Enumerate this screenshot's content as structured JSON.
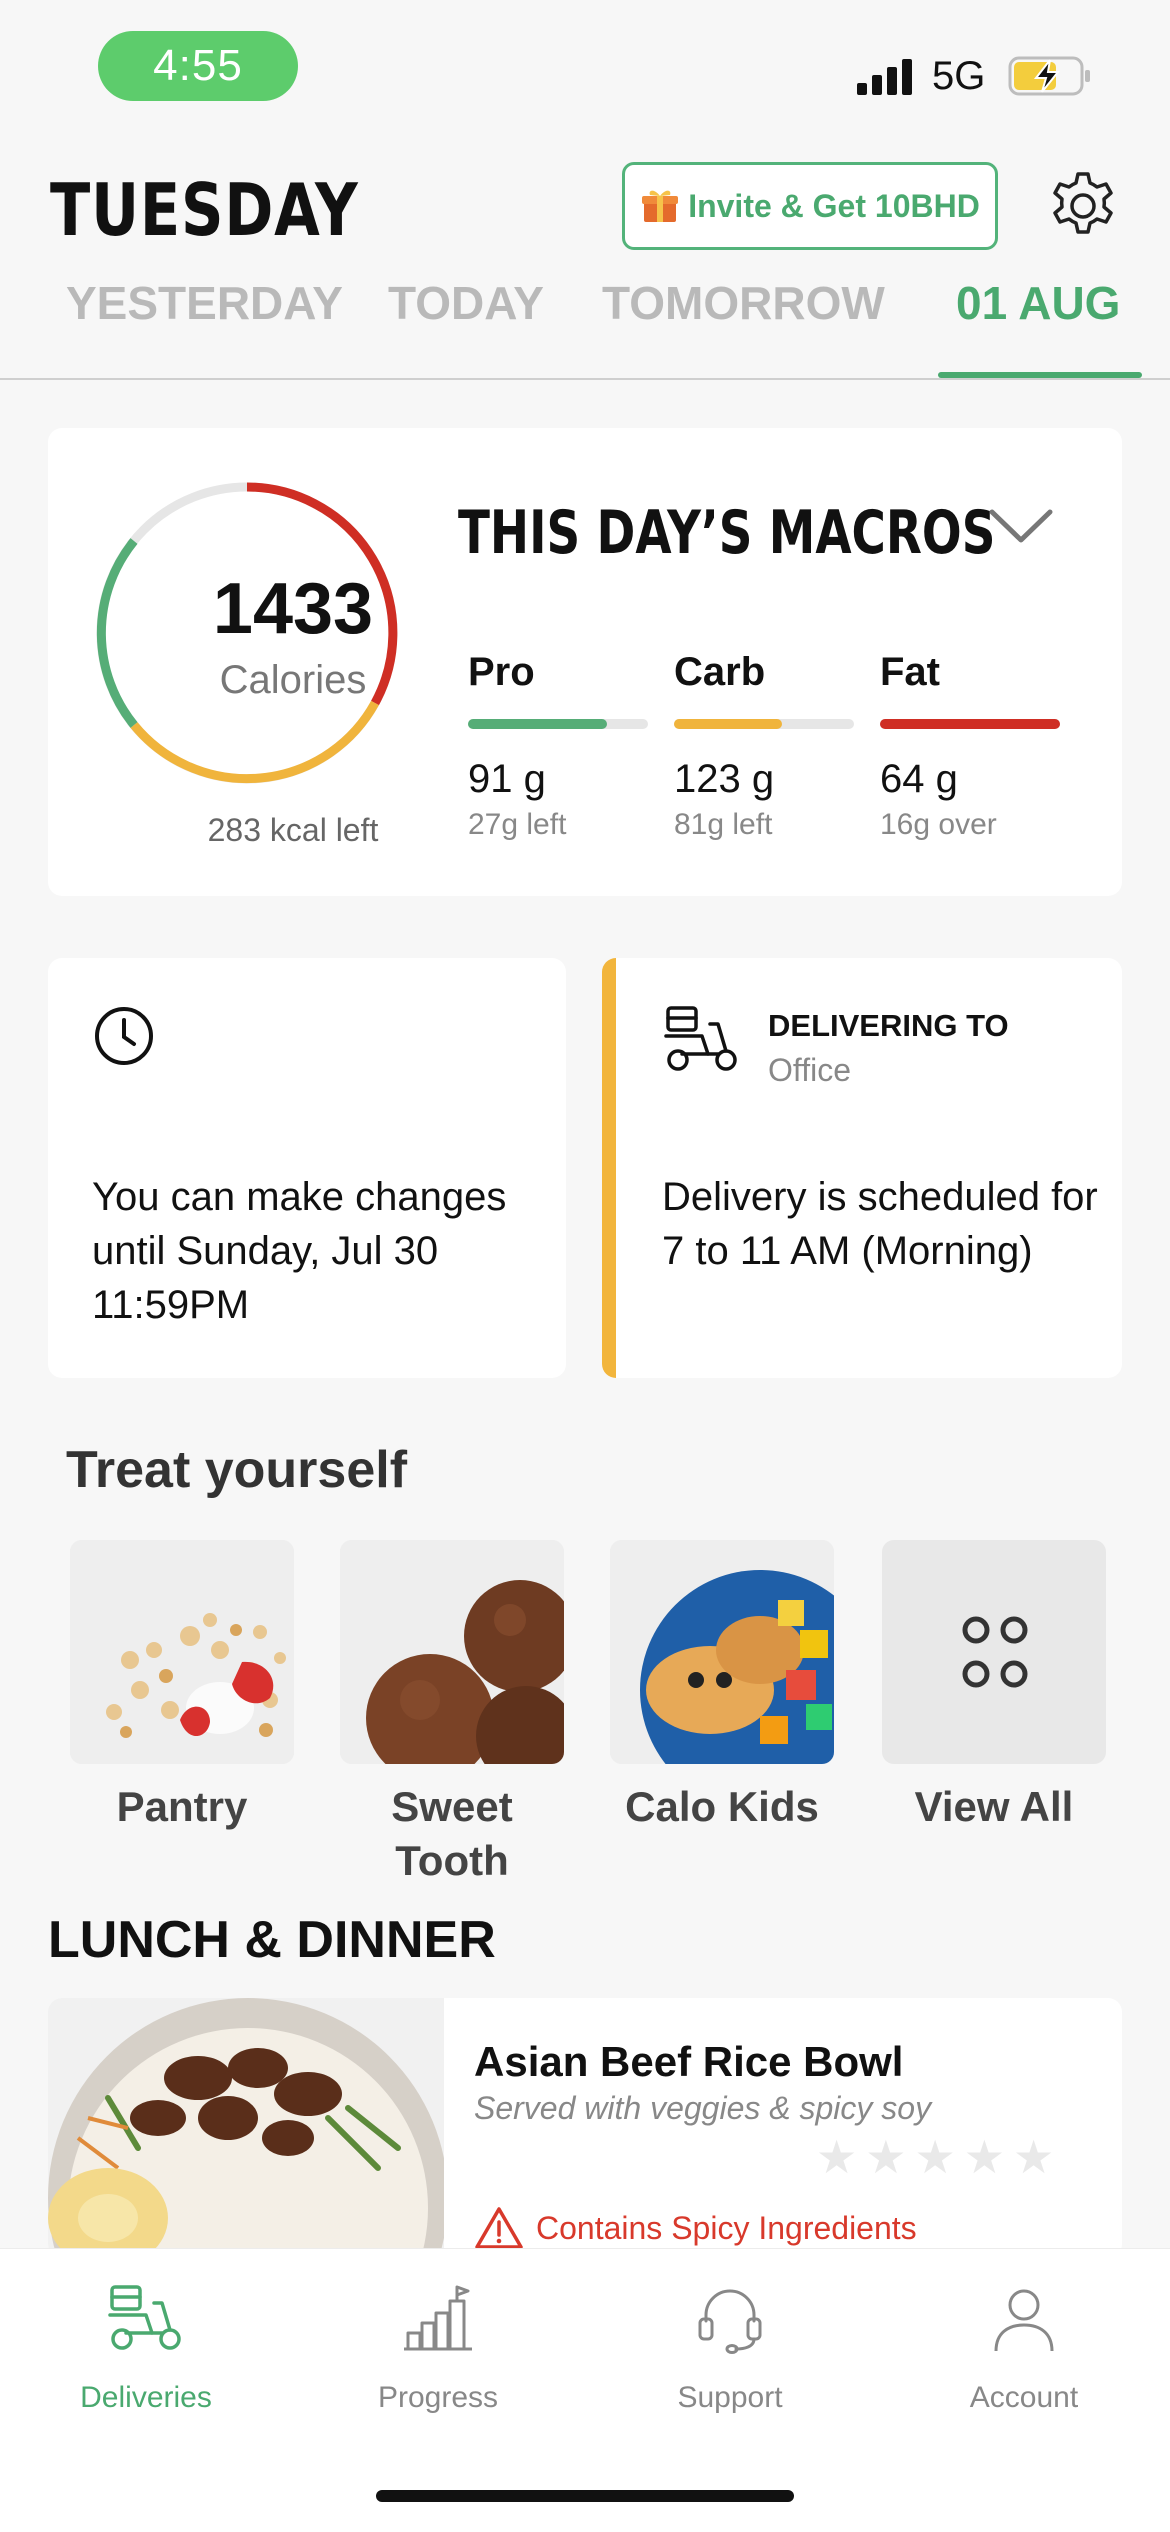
{
  "status_bar": {
    "time": "4:55",
    "network": "5G"
  },
  "header": {
    "day_title": "TUESDAY",
    "invite_label": "Invite & Get 10BHD",
    "icons": {
      "invite": "gift-icon",
      "settings": "gear-icon"
    }
  },
  "day_tabs": {
    "items": [
      {
        "label": "YESTERDAY"
      },
      {
        "label": "TODAY"
      },
      {
        "label": "TOMORROW"
      },
      {
        "label": "01 AUG"
      }
    ],
    "active_index": 3
  },
  "macros": {
    "title": "THIS DAY’S MACROS",
    "calories": "1433",
    "calories_label": "Calories",
    "kcal_left": "283 kcal left",
    "items": [
      {
        "name": "Pro",
        "amount": "91 g",
        "remaining": "27g left",
        "color": "#56ad77",
        "progress": 0.77
      },
      {
        "name": "Carb",
        "amount": "123 g",
        "remaining": "81g left",
        "color": "#f0b43c",
        "progress": 0.6
      },
      {
        "name": "Fat",
        "amount": "64 g",
        "remaining": "16g over",
        "color": "#cf2e24",
        "progress": 1.0
      }
    ]
  },
  "change_info": {
    "text": "You can make changes until Sunday, Jul 30 11:59PM",
    "icon": "clock-icon"
  },
  "delivery": {
    "label": "DELIVERING TO",
    "location": "Office",
    "text": "Delivery is scheduled for 7 to 11 AM (Morning)",
    "icon": "scooter-icon",
    "accent": "#f2b53c"
  },
  "treat": {
    "title": "Treat yourself",
    "items": [
      {
        "label": "Pantry"
      },
      {
        "label": "Sweet Tooth"
      },
      {
        "label": "Calo Kids"
      },
      {
        "label": "View All"
      }
    ]
  },
  "lunch_dinner": {
    "title": "LUNCH & DINNER",
    "meal": {
      "name": "Asian Beef Rice Bowl",
      "description": "Served with veggies & spicy soy",
      "rating": 0,
      "warning": "Contains Spicy Ingredients"
    }
  },
  "tab_bar": {
    "items": [
      {
        "label": "Deliveries",
        "icon": "scooter-icon"
      },
      {
        "label": "Progress",
        "icon": "chart-flag-icon"
      },
      {
        "label": "Support",
        "icon": "headset-icon"
      },
      {
        "label": "Account",
        "icon": "user-icon"
      }
    ],
    "active_index": 0
  },
  "colors": {
    "brand_green": "#4aa96f",
    "warning_red": "#d8392b"
  }
}
